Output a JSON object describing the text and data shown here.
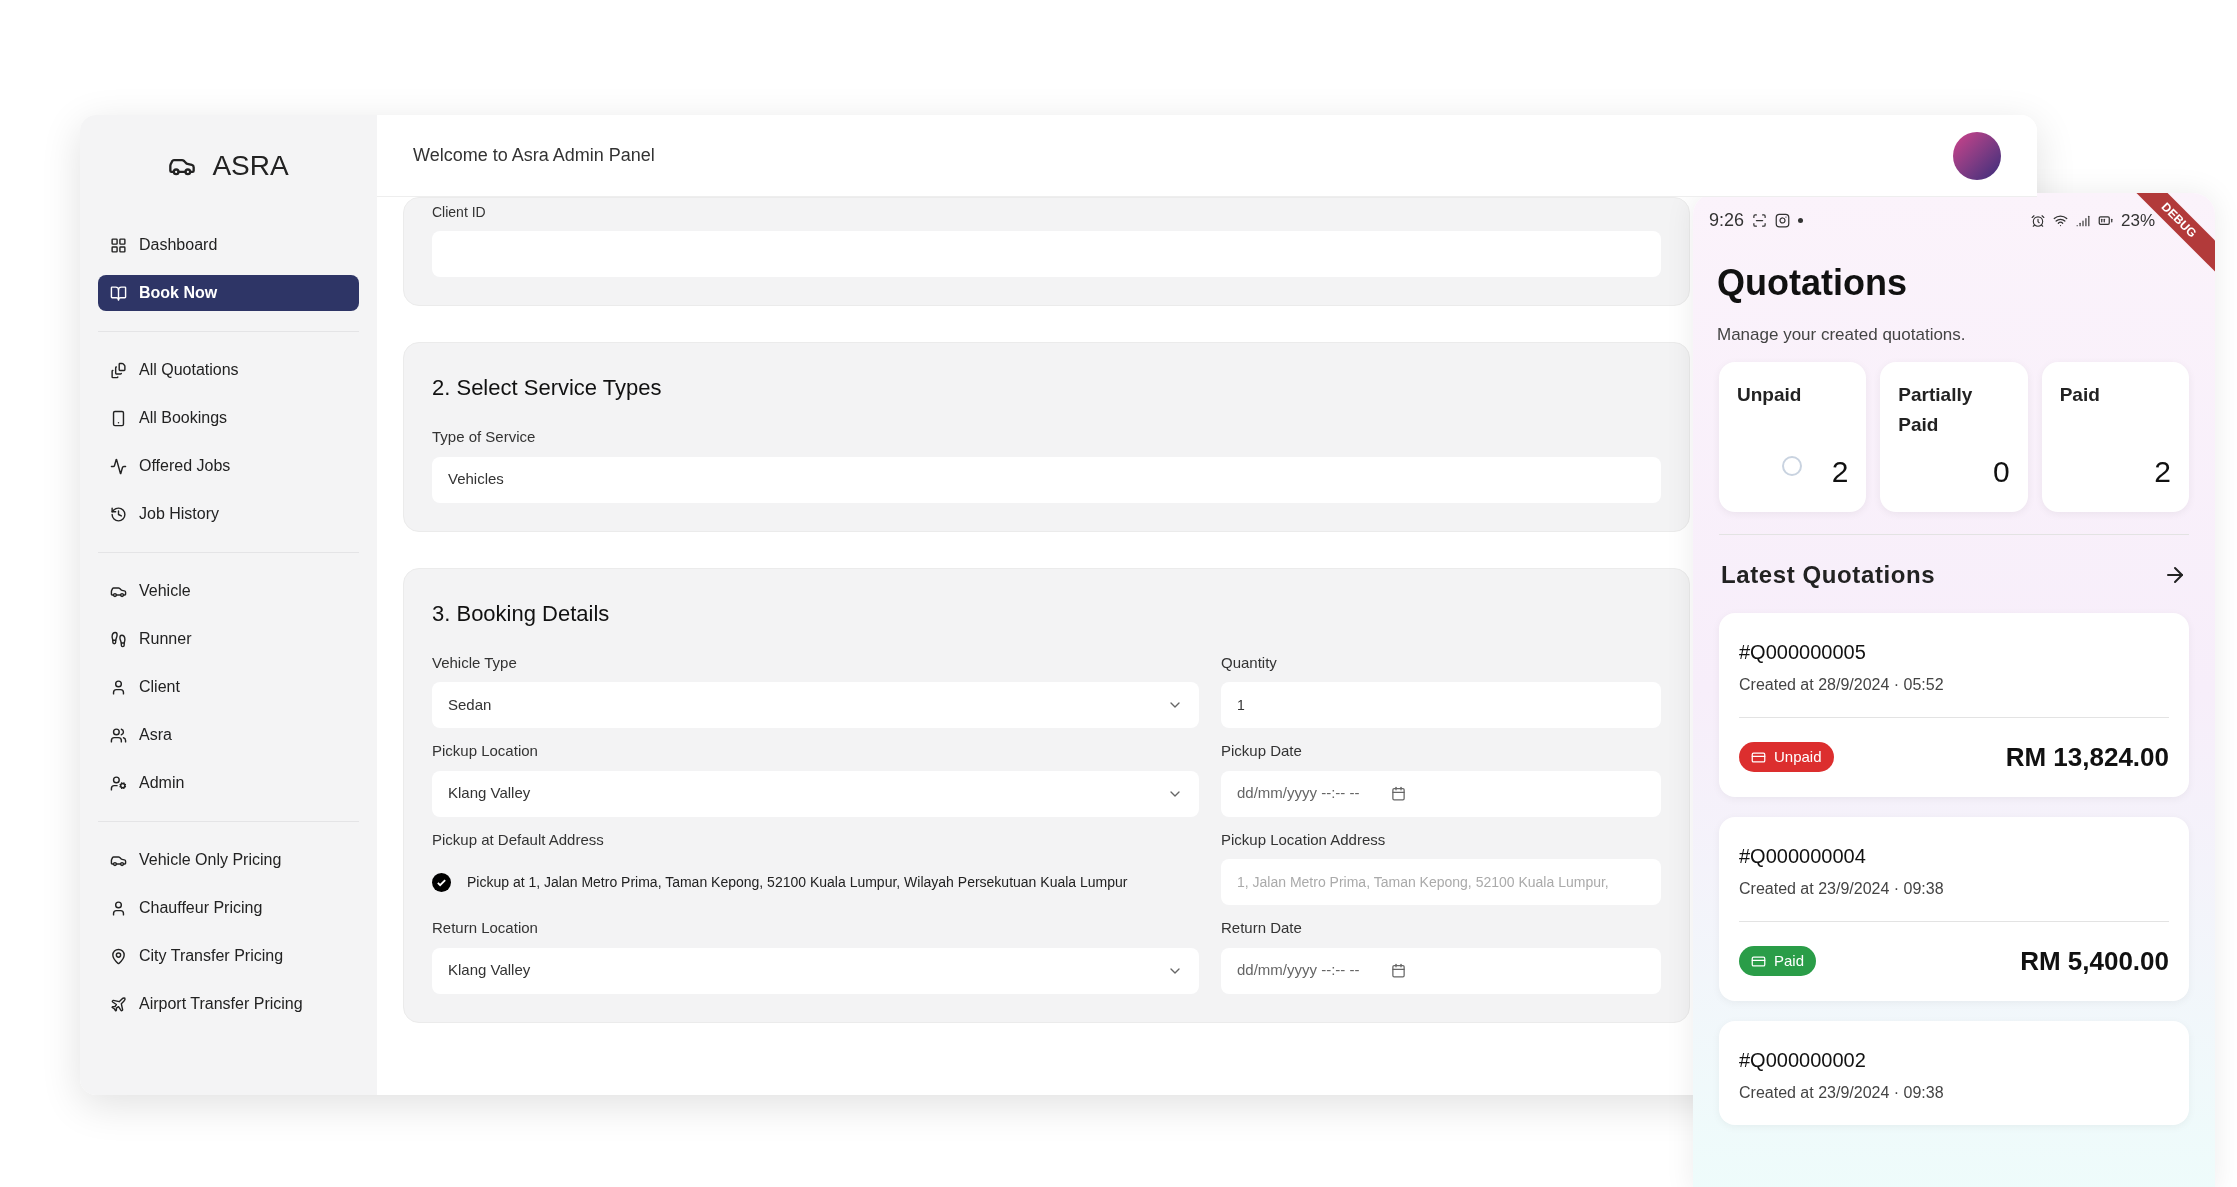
{
  "brand": {
    "name": "ASRA"
  },
  "sidebar": {
    "groups": [
      [
        {
          "label": "Dashboard",
          "selected": false
        },
        {
          "label": "Book Now",
          "selected": true
        }
      ],
      [
        {
          "label": "All Quotations",
          "selected": false
        },
        {
          "label": "All Bookings",
          "selected": false
        },
        {
          "label": "Offered Jobs",
          "selected": false
        },
        {
          "label": "Job History",
          "selected": false
        }
      ],
      [
        {
          "label": "Vehicle",
          "selected": false
        },
        {
          "label": "Runner",
          "selected": false
        },
        {
          "label": "Client",
          "selected": false
        },
        {
          "label": "Asra",
          "selected": false
        },
        {
          "label": "Admin",
          "selected": false
        }
      ],
      [
        {
          "label": "Vehicle Only Pricing",
          "selected": false
        },
        {
          "label": "Chauffeur Pricing",
          "selected": false
        },
        {
          "label": "City Transfer Pricing",
          "selected": false
        },
        {
          "label": "Airport Transfer Pricing",
          "selected": false
        }
      ]
    ]
  },
  "header": {
    "title": "Welcome to Asra Admin Panel"
  },
  "form": {
    "client": {
      "label": "Client ID"
    },
    "service": {
      "title": "2. Select Service Types",
      "label": "Type of Service",
      "value": "Vehicles"
    },
    "booking": {
      "title": "3. Booking Details",
      "rows": [
        [
          {
            "kind": "select",
            "label": "Vehicle Type",
            "value": "Sedan"
          },
          {
            "kind": "text",
            "label": "Quantity",
            "value": "1"
          }
        ],
        [
          {
            "kind": "select",
            "label": "Pickup Location",
            "value": "Klang Valley"
          },
          {
            "kind": "date",
            "label": "Pickup Date",
            "placeholder": "dd/mm/yyyy --:-- --"
          }
        ],
        [
          {
            "kind": "check",
            "label": "Pickup at Default Address",
            "text": "Pickup at 1, Jalan Metro Prima, Taman Kepong, 52100 Kuala Lumpur, Wilayah Persekutuan Kuala Lumpur",
            "checked": true
          },
          {
            "kind": "text",
            "label": "Pickup Location Address",
            "value": "1, Jalan Metro Prima, Taman Kepong, 52100 Kuala Lumpur,",
            "disabled": true
          }
        ],
        [
          {
            "kind": "select",
            "label": "Return Location",
            "value": "Klang Valley"
          },
          {
            "kind": "date",
            "label": "Return Date",
            "placeholder": "dd/mm/yyyy --:-- --"
          }
        ]
      ]
    }
  },
  "phone": {
    "status": {
      "time": "9:26",
      "battery": "23%"
    },
    "banner": "DEBUG",
    "title": "Quotations",
    "subtitle": "Manage your created quotations.",
    "stats": [
      {
        "label": "Unpaid",
        "value": "2",
        "loading": true
      },
      {
        "label": "Partially Paid",
        "value": "0",
        "loading": false
      },
      {
        "label": "Paid",
        "value": "2",
        "loading": false
      }
    ],
    "latest_title": "Latest Quotations",
    "quotations": [
      {
        "id": "#Q000000005",
        "created": "Created at 28/9/2024 · 05:52",
        "status": "Unpaid",
        "color": "#dc2e2e",
        "amount": "RM 13,824.00"
      },
      {
        "id": "#Q000000004",
        "created": "Created at 23/9/2024 · 09:38",
        "status": "Paid",
        "color": "#2a9d48",
        "amount": "RM 5,400.00"
      },
      {
        "id": "#Q000000002",
        "created": "Created at 23/9/2024 · 09:38"
      }
    ]
  }
}
